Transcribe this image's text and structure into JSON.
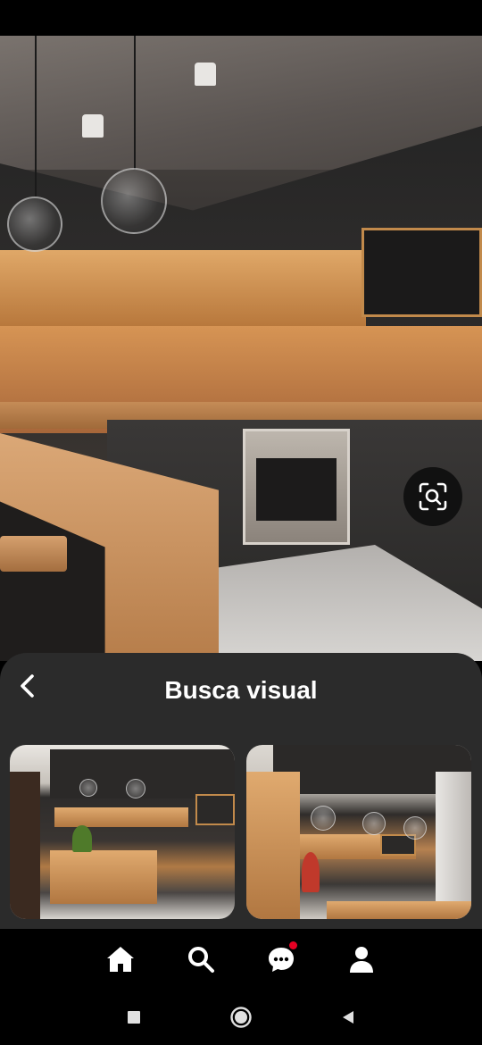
{
  "sheet": {
    "title": "Busca visual"
  },
  "icons": {
    "back": "chevron-left-icon",
    "visual_search": "visual-search-icon",
    "home": "home-icon",
    "search": "search-icon",
    "messages": "chat-bubble-icon",
    "profile": "person-icon",
    "recents": "square-icon",
    "home_system": "circle-icon",
    "back_system": "triangle-back-icon"
  },
  "colors": {
    "sheet_bg": "#2b2b2b",
    "notification_dot": "#e60023",
    "nav_icon": "#ffffff",
    "system_icon": "#e0e0e0"
  }
}
